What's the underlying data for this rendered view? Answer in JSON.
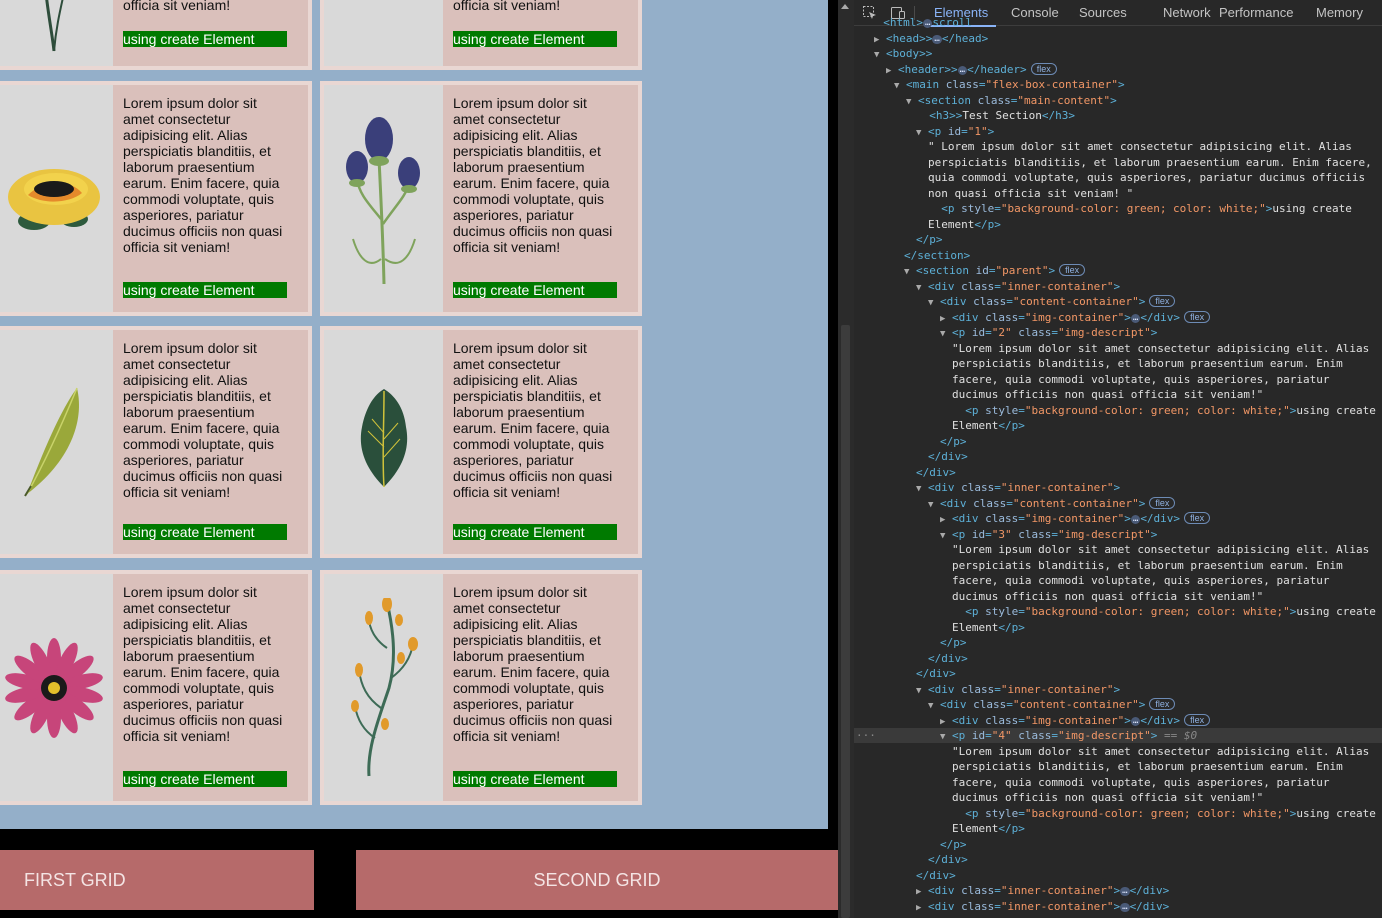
{
  "card_text": "Lorem ipsum dolor sit amet consectetur adipisicing elit. Alias perspiciatis blanditiis, et laborum praesentium earum. Enim facere, quia commodi voluptate, quis asperiores, pariatur ducimus officiis non quasi officia sit veniam!",
  "card_partial_text": "officia sit veniam!",
  "card_tag": "using create Element",
  "bottom_buttons": {
    "first": "FIRST GRID",
    "second": "SECOND GRID"
  },
  "colors": {
    "page_bg": "#94afc9",
    "card_bg": "#dac0bb",
    "tag_bg": "#007a00",
    "button_bg": "#b66a6a"
  },
  "devtools": {
    "tabs": [
      "Elements",
      "Console",
      "Sources",
      "Network",
      "Performance",
      "Memory"
    ],
    "active_tab": "Elements",
    "lines": [
      {
        "t": "<html",
        "c": "scroll"
      },
      {
        "t": "<head>",
        "c": "</head>"
      },
      {
        "t": "<body>"
      },
      {
        "t": "<header>",
        "c": "</header>",
        "p": "flex"
      },
      {
        "t": "<main",
        "a": "class",
        "v": "flex-box-container"
      },
      {
        "t": "<section",
        "a": "class",
        "v": "main-content"
      },
      {
        "t": "<h3>",
        "x": "Test Section",
        "c": "</h3>"
      },
      {
        "t": "<p",
        "a": "id",
        "v": "1"
      },
      {
        "x": "\" Lorem ipsum dolor sit amet consectetur adipisicing elit. Alias"
      },
      {
        "x": "perspiciatis blanditiis, et laborum praesentium earum. Enim facere,"
      },
      {
        "x": "quia commodi voluptate, quis asperiores, pariatur ducimus officiis"
      },
      {
        "x": "non quasi officia sit veniam! \""
      },
      {
        "t": "<p",
        "a": "style",
        "v": "background-color: green; color: white;",
        "x": "using create"
      },
      {
        "x": "Element",
        "c": "</p>"
      },
      {
        "c": "</p>"
      },
      {
        "c": "</section>"
      },
      {
        "t": "<section",
        "a": "id",
        "v": "parent",
        "p": "flex"
      },
      {
        "t": "<div",
        "a": "class",
        "v": "inner-container"
      },
      {
        "t": "<div",
        "a": "class",
        "v": "content-container",
        "p": "flex"
      },
      {
        "t": "<div",
        "a": "class",
        "v": "img-container",
        "c": "</div>",
        "p": "flex"
      },
      {
        "t": "<p",
        "a": "id",
        "v": "2",
        "a2": "class",
        "v2": "img-descript"
      },
      {
        "x": "\"Lorem ipsum dolor sit amet consectetur adipisicing elit. Alias"
      },
      {
        "x": "perspiciatis blanditiis, et laborum praesentium earum. Enim"
      },
      {
        "x": "facere, quia commodi voluptate, quis asperiores, pariatur"
      },
      {
        "x": "ducimus officiis non quasi officia sit veniam!\""
      },
      {
        "t": "<p",
        "a": "style",
        "v": "background-color: green; color: white;",
        "x": "using create"
      },
      {
        "x": "Element",
        "c": "</p>"
      },
      {
        "c": "</p>"
      },
      {
        "c": "</div>"
      },
      {
        "c": "</div>"
      },
      {
        "t": "<div",
        "a": "class",
        "v": "inner-container"
      },
      {
        "t": "<div",
        "a": "class",
        "v": "content-container",
        "p": "flex"
      },
      {
        "t": "<div",
        "a": "class",
        "v": "img-container",
        "c": "</div>",
        "p": "flex"
      },
      {
        "t": "<p",
        "a": "id",
        "v": "3",
        "a2": "class",
        "v2": "img-descript"
      },
      {
        "x": "\"Lorem ipsum dolor sit amet consectetur adipisicing elit. Alias"
      },
      {
        "x": "perspiciatis blanditiis, et laborum praesentium earum. Enim"
      },
      {
        "x": "facere, quia commodi voluptate, quis asperiores, pariatur"
      },
      {
        "x": "ducimus officiis non quasi officia sit veniam!\""
      },
      {
        "t": "<p",
        "a": "style",
        "v": "background-color: green; color: white;",
        "x": "using create"
      },
      {
        "x": "Element",
        "c": "</p>"
      },
      {
        "c": "</p>"
      },
      {
        "c": "</div>"
      },
      {
        "c": "</div>"
      },
      {
        "t": "<div",
        "a": "class",
        "v": "inner-container"
      },
      {
        "t": "<div",
        "a": "class",
        "v": "content-container",
        "p": "flex"
      },
      {
        "t": "<div",
        "a": "class",
        "v": "img-container",
        "c": "</div>",
        "p": "flex"
      },
      {
        "t": "<p",
        "a": "id",
        "v": "4",
        "a2": "class",
        "v2": "img-descript",
        "s": "== $0"
      },
      {
        "x": "\"Lorem ipsum dolor sit amet consectetur adipisicing elit. Alias"
      },
      {
        "x": "perspiciatis blanditiis, et laborum praesentium earum. Enim"
      },
      {
        "x": "facere, quia commodi voluptate, quis asperiores, pariatur"
      },
      {
        "x": "ducimus officiis non quasi officia sit veniam!\""
      },
      {
        "t": "<p",
        "a": "style",
        "v": "background-color: green; color: white;",
        "x": "using create"
      },
      {
        "x": "Element",
        "c": "</p>"
      },
      {
        "c": "</p>"
      },
      {
        "c": "</div>"
      },
      {
        "c": "</div>"
      },
      {
        "t": "<div",
        "a": "class",
        "v": "inner-container",
        "c": "</div>"
      },
      {
        "t": "<div",
        "a": "class",
        "v": "inner-container",
        "c": "</div>"
      }
    ]
  }
}
